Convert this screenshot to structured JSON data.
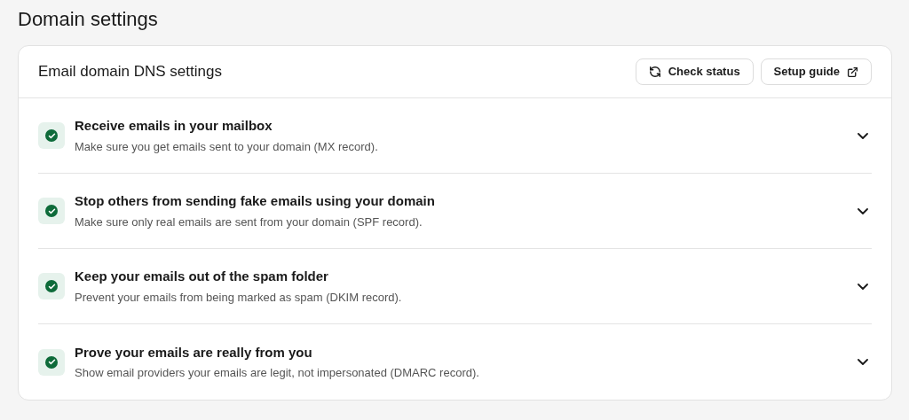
{
  "page_title": "Domain settings",
  "card": {
    "title": "Email domain DNS settings",
    "buttons": [
      {
        "label": "Check status",
        "kind": "refresh"
      },
      {
        "label": "Setup guide",
        "kind": "external"
      }
    ]
  },
  "items": [
    {
      "title": "Receive emails in your mailbox",
      "description": "Make sure you get emails sent to your domain (MX record).",
      "verified": true,
      "expanded": false
    },
    {
      "title": "Stop others from sending fake emails using your domain",
      "description": "Make sure only real emails are sent from your domain (SPF record).",
      "verified": true,
      "expanded": false
    },
    {
      "title": "Keep your emails out of the spam folder",
      "description": "Prevent your emails from being marked as spam (DKIM record).",
      "verified": true,
      "expanded": false
    },
    {
      "title": "Prove your emails are really from you",
      "description": "Show email providers your emails are legit, not impersonated (DMARC record).",
      "verified": true,
      "expanded": false
    }
  ]
}
